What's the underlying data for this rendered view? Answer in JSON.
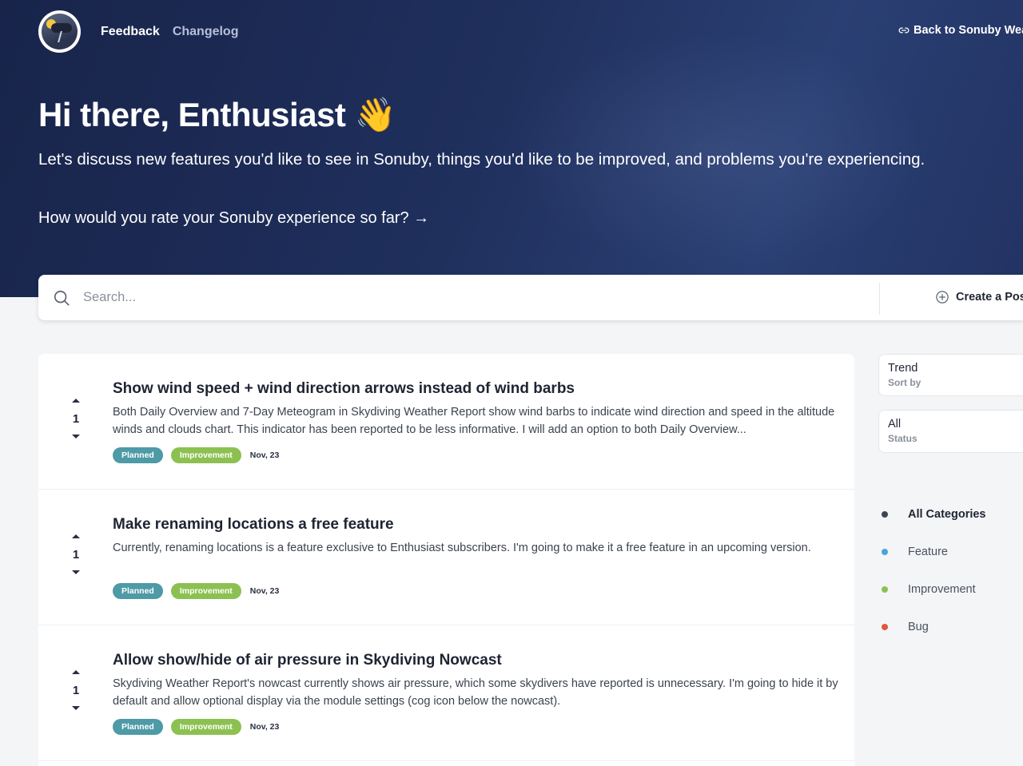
{
  "nav": {
    "feedback": "Feedback",
    "changelog": "Changelog",
    "back_link": "Back to Sonuby Wea"
  },
  "hero": {
    "greeting": "Hi there, Enthusiast 👋",
    "intro": "Let's discuss new features you'd like to see in Sonuby, things you'd like to be improved, and problems you're experiencing.",
    "rate_prompt": "How would you rate your Sonuby experience so far? →"
  },
  "search": {
    "placeholder": "Search...",
    "create_label": "Create a Pos"
  },
  "posts": [
    {
      "votes": "1",
      "title": "Show wind speed + wind direction arrows instead of wind barbs",
      "description": "Both Daily Overview and 7-Day Meteogram in Skydiving Weather Report show wind barbs to indicate wind direction and speed in the altitude winds and clouds chart. This indicator has been reported to be less informative. I will add an option to both Daily Overview...",
      "status": "Planned",
      "category": "Improvement",
      "date": "Nov, 23"
    },
    {
      "votes": "1",
      "title": "Make renaming locations a free feature",
      "description": "Currently, renaming locations is a feature exclusive to Enthusiast subscribers. I'm going to make it a free feature in an upcoming version.",
      "status": "Planned",
      "category": "Improvement",
      "date": "Nov, 23"
    },
    {
      "votes": "1",
      "title": "Allow show/hide of air pressure in Skydiving Nowcast",
      "description": "Skydiving Weather Report's nowcast currently shows air pressure, which some skydivers have reported is unnecessary. I'm going to hide it by default and allow optional display via the module settings (cog icon below the nowcast).",
      "status": "Planned",
      "category": "Improvement",
      "date": "Nov, 23"
    }
  ],
  "filters": {
    "sort": {
      "value": "Trend",
      "label": "Sort by"
    },
    "status": {
      "value": "All",
      "label": "Status"
    }
  },
  "categories": [
    {
      "name": "All Categories",
      "color": "#3d4454"
    },
    {
      "name": "Feature",
      "color": "#4aa3df"
    },
    {
      "name": "Improvement",
      "color": "#8cc152"
    },
    {
      "name": "Bug",
      "color": "#e0593a"
    }
  ],
  "colors": {
    "planned": "#4e9aa6",
    "improvement": "#8cc152",
    "hero_bg": "#1f2f5c"
  }
}
